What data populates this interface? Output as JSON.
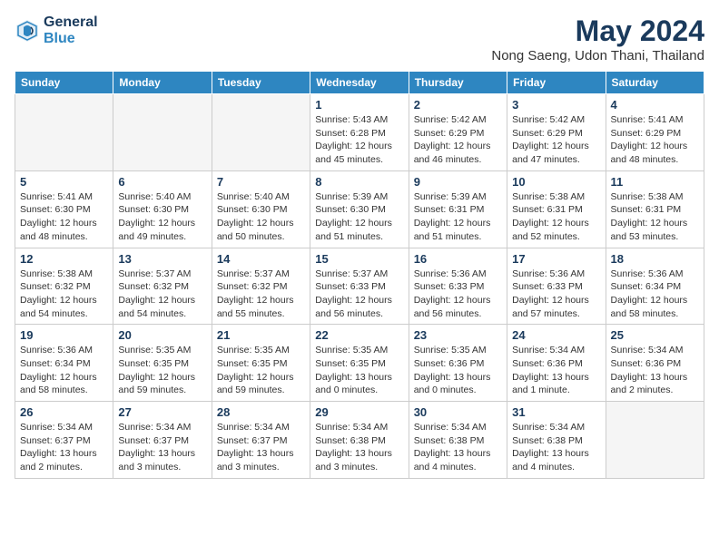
{
  "header": {
    "logo_line1": "General",
    "logo_line2": "Blue",
    "month_title": "May 2024",
    "location": "Nong Saeng, Udon Thani, Thailand"
  },
  "days_of_week": [
    "Sunday",
    "Monday",
    "Tuesday",
    "Wednesday",
    "Thursday",
    "Friday",
    "Saturday"
  ],
  "weeks": [
    [
      {
        "num": "",
        "info": ""
      },
      {
        "num": "",
        "info": ""
      },
      {
        "num": "",
        "info": ""
      },
      {
        "num": "1",
        "info": "Sunrise: 5:43 AM\nSunset: 6:28 PM\nDaylight: 12 hours\nand 45 minutes."
      },
      {
        "num": "2",
        "info": "Sunrise: 5:42 AM\nSunset: 6:29 PM\nDaylight: 12 hours\nand 46 minutes."
      },
      {
        "num": "3",
        "info": "Sunrise: 5:42 AM\nSunset: 6:29 PM\nDaylight: 12 hours\nand 47 minutes."
      },
      {
        "num": "4",
        "info": "Sunrise: 5:41 AM\nSunset: 6:29 PM\nDaylight: 12 hours\nand 48 minutes."
      }
    ],
    [
      {
        "num": "5",
        "info": "Sunrise: 5:41 AM\nSunset: 6:30 PM\nDaylight: 12 hours\nand 48 minutes."
      },
      {
        "num": "6",
        "info": "Sunrise: 5:40 AM\nSunset: 6:30 PM\nDaylight: 12 hours\nand 49 minutes."
      },
      {
        "num": "7",
        "info": "Sunrise: 5:40 AM\nSunset: 6:30 PM\nDaylight: 12 hours\nand 50 minutes."
      },
      {
        "num": "8",
        "info": "Sunrise: 5:39 AM\nSunset: 6:30 PM\nDaylight: 12 hours\nand 51 minutes."
      },
      {
        "num": "9",
        "info": "Sunrise: 5:39 AM\nSunset: 6:31 PM\nDaylight: 12 hours\nand 51 minutes."
      },
      {
        "num": "10",
        "info": "Sunrise: 5:38 AM\nSunset: 6:31 PM\nDaylight: 12 hours\nand 52 minutes."
      },
      {
        "num": "11",
        "info": "Sunrise: 5:38 AM\nSunset: 6:31 PM\nDaylight: 12 hours\nand 53 minutes."
      }
    ],
    [
      {
        "num": "12",
        "info": "Sunrise: 5:38 AM\nSunset: 6:32 PM\nDaylight: 12 hours\nand 54 minutes."
      },
      {
        "num": "13",
        "info": "Sunrise: 5:37 AM\nSunset: 6:32 PM\nDaylight: 12 hours\nand 54 minutes."
      },
      {
        "num": "14",
        "info": "Sunrise: 5:37 AM\nSunset: 6:32 PM\nDaylight: 12 hours\nand 55 minutes."
      },
      {
        "num": "15",
        "info": "Sunrise: 5:37 AM\nSunset: 6:33 PM\nDaylight: 12 hours\nand 56 minutes."
      },
      {
        "num": "16",
        "info": "Sunrise: 5:36 AM\nSunset: 6:33 PM\nDaylight: 12 hours\nand 56 minutes."
      },
      {
        "num": "17",
        "info": "Sunrise: 5:36 AM\nSunset: 6:33 PM\nDaylight: 12 hours\nand 57 minutes."
      },
      {
        "num": "18",
        "info": "Sunrise: 5:36 AM\nSunset: 6:34 PM\nDaylight: 12 hours\nand 58 minutes."
      }
    ],
    [
      {
        "num": "19",
        "info": "Sunrise: 5:36 AM\nSunset: 6:34 PM\nDaylight: 12 hours\nand 58 minutes."
      },
      {
        "num": "20",
        "info": "Sunrise: 5:35 AM\nSunset: 6:35 PM\nDaylight: 12 hours\nand 59 minutes."
      },
      {
        "num": "21",
        "info": "Sunrise: 5:35 AM\nSunset: 6:35 PM\nDaylight: 12 hours\nand 59 minutes."
      },
      {
        "num": "22",
        "info": "Sunrise: 5:35 AM\nSunset: 6:35 PM\nDaylight: 13 hours\nand 0 minutes."
      },
      {
        "num": "23",
        "info": "Sunrise: 5:35 AM\nSunset: 6:36 PM\nDaylight: 13 hours\nand 0 minutes."
      },
      {
        "num": "24",
        "info": "Sunrise: 5:34 AM\nSunset: 6:36 PM\nDaylight: 13 hours\nand 1 minute."
      },
      {
        "num": "25",
        "info": "Sunrise: 5:34 AM\nSunset: 6:36 PM\nDaylight: 13 hours\nand 2 minutes."
      }
    ],
    [
      {
        "num": "26",
        "info": "Sunrise: 5:34 AM\nSunset: 6:37 PM\nDaylight: 13 hours\nand 2 minutes."
      },
      {
        "num": "27",
        "info": "Sunrise: 5:34 AM\nSunset: 6:37 PM\nDaylight: 13 hours\nand 3 minutes."
      },
      {
        "num": "28",
        "info": "Sunrise: 5:34 AM\nSunset: 6:37 PM\nDaylight: 13 hours\nand 3 minutes."
      },
      {
        "num": "29",
        "info": "Sunrise: 5:34 AM\nSunset: 6:38 PM\nDaylight: 13 hours\nand 3 minutes."
      },
      {
        "num": "30",
        "info": "Sunrise: 5:34 AM\nSunset: 6:38 PM\nDaylight: 13 hours\nand 4 minutes."
      },
      {
        "num": "31",
        "info": "Sunrise: 5:34 AM\nSunset: 6:38 PM\nDaylight: 13 hours\nand 4 minutes."
      },
      {
        "num": "",
        "info": ""
      }
    ]
  ]
}
